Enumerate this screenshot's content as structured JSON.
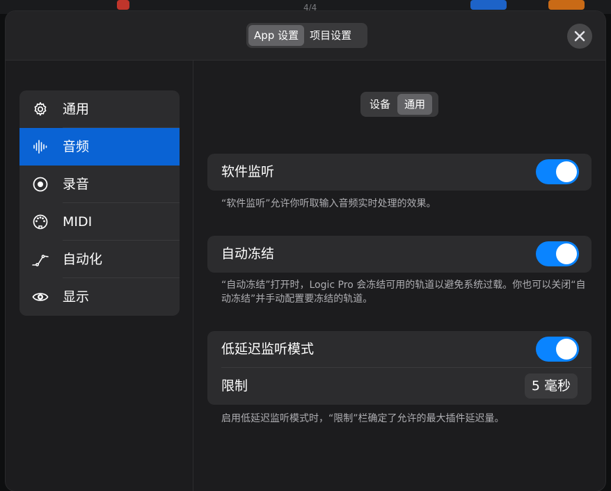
{
  "background": {
    "counter": "4/4"
  },
  "header": {
    "tabs": [
      {
        "label": "App 设置",
        "active": true
      },
      {
        "label": "项目设置",
        "active": false
      }
    ]
  },
  "sidebar": {
    "items": [
      {
        "label": "通用",
        "icon": "gear-icon",
        "active": false
      },
      {
        "label": "音频",
        "icon": "waveform-icon",
        "active": true
      },
      {
        "label": "录音",
        "icon": "record-icon",
        "active": false
      },
      {
        "label": "MIDI",
        "icon": "midi-port-icon",
        "active": false
      },
      {
        "label": "自动化",
        "icon": "automation-curve-icon",
        "active": false
      },
      {
        "label": "显示",
        "icon": "eye-icon",
        "active": false
      }
    ]
  },
  "subtabs": [
    {
      "label": "设备",
      "active": false
    },
    {
      "label": "通用",
      "active": true
    }
  ],
  "settings": {
    "software_monitoring": {
      "label": "软件监听",
      "enabled": true,
      "description": "“软件监听”允许你听取输入音频实时处理的效果。"
    },
    "auto_freeze": {
      "label": "自动冻结",
      "enabled": true,
      "description": "“自动冻结”打开时，Logic Pro 会冻结可用的轨道以避免系统过载。你也可以关闭“自动冻结”并手动配置要冻结的轨道。"
    },
    "low_latency": {
      "label": "低延迟监听模式",
      "enabled": true,
      "limit_label": "限制",
      "limit_value": "5 毫秒",
      "description": "启用低延迟监听模式时，“限制”栏确定了允许的最大插件延迟量。"
    }
  },
  "colors": {
    "accent": "#0a84ff",
    "sidebar_selected": "#0a63d4",
    "panel": "#1c1c1e",
    "card": "#2c2c2e"
  }
}
